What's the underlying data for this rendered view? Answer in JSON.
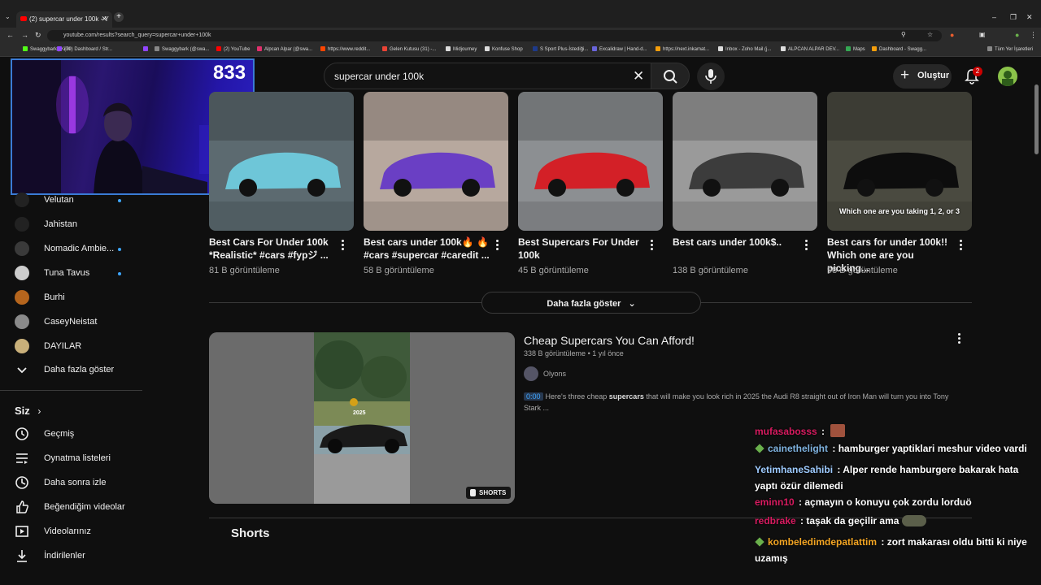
{
  "browser": {
    "tab_title": "(2) supercar under 100k - Y",
    "url": "youtube.com/results?search_query=supercar+under+100k",
    "bookmarks": [
      {
        "label": "Swaggybark | Kick",
        "color": "#53fc18"
      },
      {
        "label": "(79) Dashboard / Str...",
        "color": "#9146ff"
      },
      {
        "label": "",
        "color": "#9146ff"
      },
      {
        "label": "Swaggybark (@swa...",
        "color": "#888888"
      },
      {
        "label": "(2) YouTube",
        "color": "#ff0000"
      },
      {
        "label": "Alpcan Alpar (@swa...",
        "color": "#e1306c"
      },
      {
        "label": "https://www.reddit...",
        "color": "#ff4500"
      },
      {
        "label": "Gelen Kutusu (31) -...",
        "color": "#ea4335"
      },
      {
        "label": "Midjourney",
        "color": "#dddddd"
      },
      {
        "label": "Konfuse Shop",
        "color": "#dddddd"
      },
      {
        "label": "S Sport Plus-İstediği...",
        "color": "#1e3a8a"
      },
      {
        "label": "Excalidraw | Hand-d...",
        "color": "#6965db"
      },
      {
        "label": "https://next.inkamat...",
        "color": "#f59e0b"
      },
      {
        "label": "Inbox - Zoho Mail (j...",
        "color": "#dddddd"
      },
      {
        "label": "ALPCAN ALPAR DEV...",
        "color": "#dddddd"
      },
      {
        "label": "Maps",
        "color": "#34a853"
      },
      {
        "label": "Dashboard - Swagg...",
        "color": "#f59e0b"
      }
    ],
    "all_bookmarks": "Tüm Yer İşaretleri"
  },
  "header": {
    "search_value": "supercar under 100k",
    "create_label": "Oluştur",
    "notification_count": "2"
  },
  "webcam": {
    "counter": "833"
  },
  "sidebar": {
    "subscriptions": [
      {
        "label": "Velutan",
        "dot": true,
        "color": "#222222"
      },
      {
        "label": "Jahistan",
        "dot": false,
        "color": "#222222"
      },
      {
        "label": "Nomadic Ambie...",
        "dot": true,
        "color": "#3a3a3a"
      },
      {
        "label": "Tuna Tavus",
        "dot": true,
        "color": "#cccccc"
      },
      {
        "label": "Burhi",
        "dot": false,
        "color": "#b5651d"
      },
      {
        "label": "CaseyNeistat",
        "dot": false,
        "color": "#8a8a8a"
      },
      {
        "label": "DAYILAR",
        "dot": false,
        "color": "#c9b07a"
      }
    ],
    "show_more": "Daha fazla göster",
    "you_heading": "Siz",
    "you_items": [
      {
        "label": "Geçmiş",
        "icon": "history-icon"
      },
      {
        "label": "Oynatma listeleri",
        "icon": "playlists-icon"
      },
      {
        "label": "Daha sonra izle",
        "icon": "watch-later-icon"
      },
      {
        "label": "Beğendiğim videolar",
        "icon": "liked-icon"
      },
      {
        "label": "Videolarınız",
        "icon": "your-videos-icon"
      },
      {
        "label": "İndirilenler",
        "icon": "downloads-icon"
      }
    ]
  },
  "shorts_row": [
    {
      "title": "Best Cars For Under 100k *Realistic* #cars #fypジ ...",
      "views": "81 B görüntüleme",
      "bg": "#5c6a70",
      "accent": "#6ec6d8",
      "caption": ""
    },
    {
      "title": "Best cars under 100k🔥 🔥 #cars #supercar #caredit ...",
      "views": "58 B görüntüleme",
      "bg": "#b7a89e",
      "accent": "#6a3fc4",
      "caption": ""
    },
    {
      "title": "Best Supercars For Under 100k",
      "views": "45 B görüntüleme",
      "bg": "#8c8f92",
      "accent": "#d32027",
      "caption": ""
    },
    {
      "title": "Best cars under 100k$..",
      "views": "138 B görüntüleme",
      "bg": "#9a9a9a",
      "accent": "#3c3c3c",
      "caption": ""
    },
    {
      "title": "Best cars for under 100k!! Which one are you picking...",
      "views": "98 B görüntüleme",
      "bg": "#4a4a40",
      "accent": "#0d0d0d",
      "caption": "Which one are you taking 1, 2, or 3"
    }
  ],
  "show_more_button": "Daha fazla göster",
  "result": {
    "title": "Cheap Supercars You Can Afford!",
    "views": "338 B görüntüleme",
    "age": "1 yıl önce",
    "channel": "Olyons",
    "timestamp": "0:00",
    "desc_before": "Here's three cheap ",
    "desc_bold": "supercars",
    "desc_after": " that will make you look rich in 2025 the Audi R8 straight out of Iron Man will turn you into Tony Stark ...",
    "badge": "SHORTS",
    "thumb_year": "2025"
  },
  "shorts_heading": "Shorts",
  "chat": [
    {
      "user": "mufasabosss",
      "color": "#d81b60",
      "badge": false,
      "text": ""
    },
    {
      "user": "cainethelight",
      "color": "#7fb3e0",
      "badge": true,
      "text": "hamburger yaptiklari meshur video vardi"
    },
    {
      "user": "YetimhaneSahibi",
      "color": "#9ecbff",
      "badge": false,
      "text": "Alper rende hamburgere bakarak hata yaptı özür dilemedi"
    },
    {
      "user": "eminn10",
      "color": "#d81b60",
      "badge": false,
      "text": "açmayın o konuyu çok zordu lorduö"
    },
    {
      "user": "redbrake",
      "color": "#d81b60",
      "badge": false,
      "text": "taşak da geçilir ama"
    },
    {
      "user": "kombeledimdepatlattim",
      "color": "#f5a623",
      "badge": true,
      "text": "zort makarası oldu bitti ki niye uzamış"
    }
  ]
}
